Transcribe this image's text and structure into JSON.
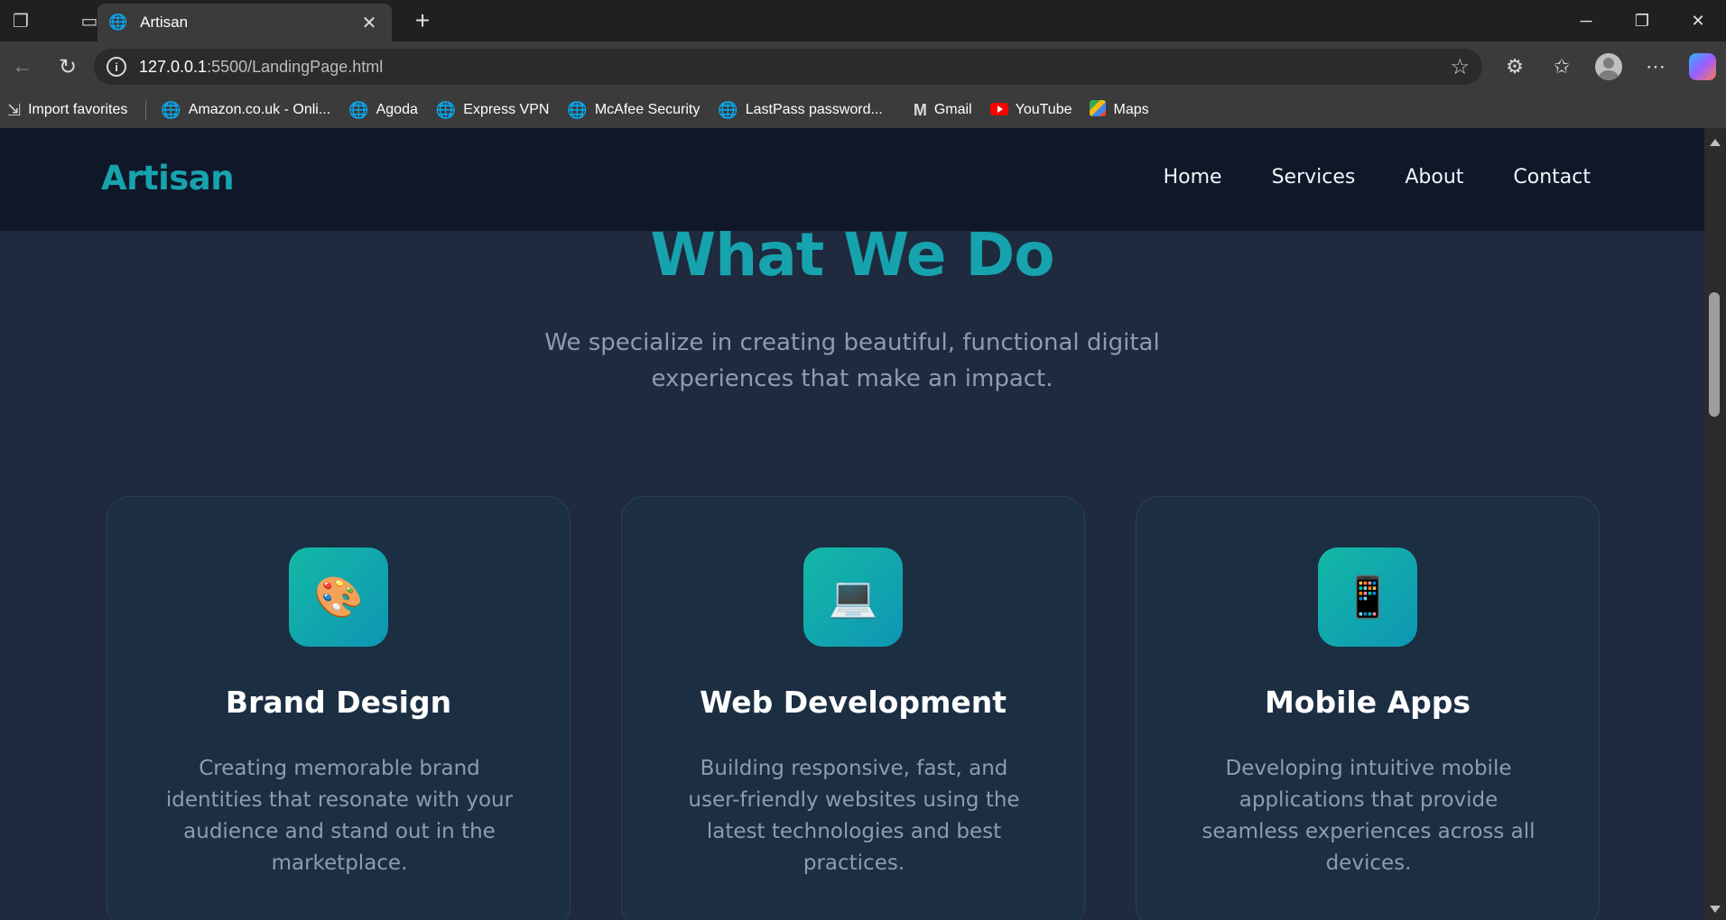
{
  "browser": {
    "tab_title": "Artisan",
    "url_host": "127.0.0.1",
    "url_rest": ":5500/LandingPage.html",
    "bookmarks": [
      {
        "label": "Import favorites"
      },
      {
        "label": "Amazon.co.uk - Onli..."
      },
      {
        "label": "Agoda"
      },
      {
        "label": "Express VPN"
      },
      {
        "label": "McAfee Security"
      },
      {
        "label": "LastPass password..."
      },
      {
        "label": "Gmail"
      },
      {
        "label": "YouTube"
      },
      {
        "label": "Maps"
      }
    ]
  },
  "site": {
    "logo": "Artisan",
    "nav": [
      "Home",
      "Services",
      "About",
      "Contact"
    ],
    "section_title": "What We Do",
    "section_subtitle": "We specialize in creating beautiful, functional digital experiences that make an impact.",
    "services": [
      {
        "icon": "🎨",
        "icon_name": "palette-icon",
        "title": "Brand Design",
        "description": "Creating memorable brand identities that resonate with your audience and stand out in the marketplace."
      },
      {
        "icon": "💻",
        "icon_name": "laptop-icon",
        "title": "Web Development",
        "description": "Building responsive, fast, and user-friendly websites using the latest technologies and best practices."
      },
      {
        "icon": "📱",
        "icon_name": "mobile-phone-icon",
        "title": "Mobile Apps",
        "description": "Developing intuitive mobile applications that provide seamless experiences across all devices."
      }
    ]
  },
  "colors": {
    "accent": "#17a3ae",
    "nav_bg": "#0f1729",
    "page_bg": "#1f2a3e",
    "card_bg": "#1c2e42",
    "icon_gradient_start": "#14b8a6",
    "icon_gradient_end": "#0e96b4"
  }
}
